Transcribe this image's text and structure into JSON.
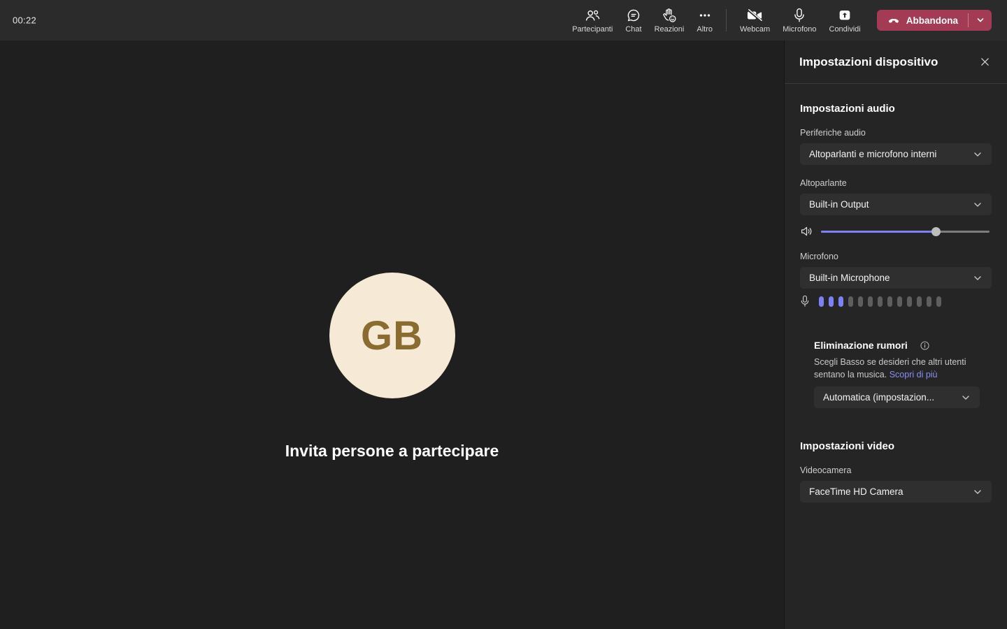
{
  "app": {
    "accent_color": "#7c81f4",
    "link_color": "#8b8ef2",
    "leave_color": "#a33b55"
  },
  "toolbar": {
    "timer": "00:22",
    "items": [
      {
        "label": "Partecipanti",
        "icon": "people-icon"
      },
      {
        "label": "Chat",
        "icon": "chat-icon"
      },
      {
        "label": "Reazioni",
        "icon": "reactions-icon"
      },
      {
        "label": "Altro",
        "icon": "ellipsis-icon"
      },
      {
        "label": "Webcam",
        "icon": "webcam-off-icon"
      },
      {
        "label": "Microfono",
        "icon": "microphone-icon"
      },
      {
        "label": "Condividi",
        "icon": "share-icon"
      }
    ],
    "leave": {
      "label": "Abbandona",
      "icon": "hangup-icon",
      "menu_icon": "chevron-down-icon"
    }
  },
  "stage": {
    "avatar": {
      "initials": "GB",
      "bg": "#f6ead6",
      "fg": "#8a6c31"
    },
    "invite_text": "Invita persone a partecipare"
  },
  "panel": {
    "title": "Impostazioni dispositivo",
    "audio": {
      "heading": "Impostazioni audio",
      "devices_label": "Periferiche audio",
      "devices_value": "Altoparlanti e microfono interni",
      "speaker_label": "Altoparlante",
      "speaker_value": "Built-in Output",
      "volume_percent": 68,
      "mic_label": "Microfono",
      "mic_value": "Built-in Microphone",
      "mic_level": {
        "total": 13,
        "active": 3
      },
      "noise": {
        "heading": "Eliminazione rumori",
        "description": "Scegli Basso se desideri che altri utenti sentano la musica.",
        "link": "Scopri di più",
        "value": "Automatica (impostazion..."
      }
    },
    "video": {
      "heading": "Impostazioni video",
      "camera_label": "Videocamera",
      "camera_value": "FaceTime HD Camera"
    }
  }
}
